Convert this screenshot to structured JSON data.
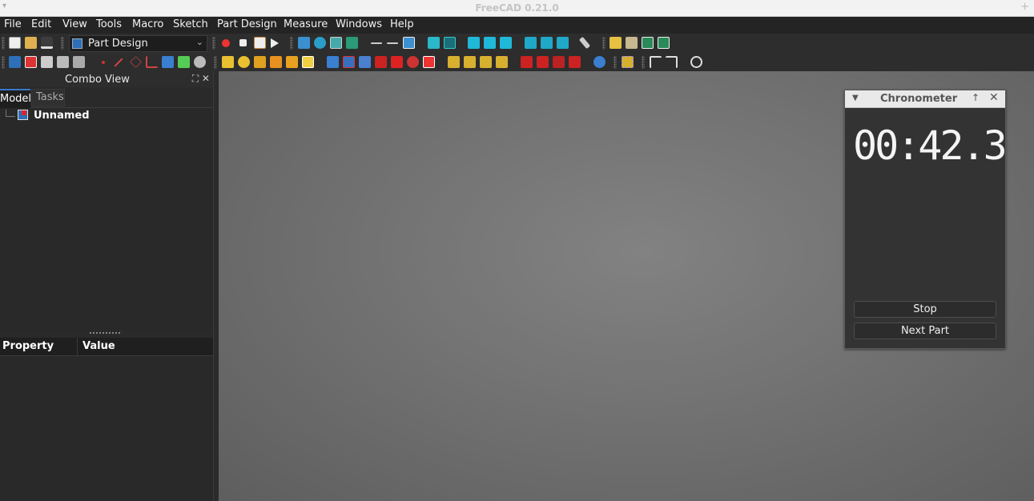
{
  "window": {
    "title": "FreeCAD 0.21.0",
    "left_glyph": "▾",
    "right_glyph": "+"
  },
  "menu": [
    "File",
    "Edit",
    "View",
    "Tools",
    "Macro",
    "Sketch",
    "Part Design",
    "Measure",
    "Windows",
    "Help"
  ],
  "workbench": {
    "selected": "Part Design"
  },
  "combo_view": {
    "title": "Combo View",
    "tabs": [
      "Model",
      "Tasks"
    ],
    "active_tab": "Model"
  },
  "tree": {
    "items": [
      {
        "label": "Unnamed",
        "icon": "document-icon"
      }
    ]
  },
  "property_view": {
    "columns": [
      "Property",
      "Value"
    ]
  },
  "chronometer": {
    "title": "Chronometer",
    "time": "00:42.3",
    "buttons": [
      "Stop",
      "Next Part"
    ]
  },
  "icons": {
    "toolbar_row1": [
      "new-document-icon",
      "open-icon",
      "save-icon",
      "workbench-icon",
      "record-macro-icon",
      "stop-macro-icon",
      "edit-macro-icon",
      "run-macro-icon",
      "fit-all-icon",
      "fit-selection-icon",
      "draw-style-icon",
      "bounding-box-icon",
      "back-icon",
      "forward-icon",
      "link-icon",
      "view-menu-icon",
      "isometric-icon",
      "front-view-icon",
      "top-view-icon",
      "right-view-icon",
      "rear-view-icon",
      "bottom-view-icon",
      "left-view-icon",
      "measure-icon",
      "part-icon",
      "group-icon",
      "link-make-icon",
      "link-actions-icon"
    ],
    "toolbar_row2": [
      "body-icon",
      "create-sketch-icon",
      "validate-sketch-icon",
      "shape-binder-icon",
      "clone-icon",
      "point-icon",
      "line-icon",
      "plane-icon",
      "csys-icon",
      "subshape-binder-icon",
      "primitives-icon",
      "pad-icon",
      "revolution-icon",
      "loft-icon",
      "pipe-icon",
      "helix-icon",
      "additive-box-icon",
      "pocket-icon",
      "hole-icon",
      "groove-icon",
      "subtractive-loft-icon",
      "subtractive-pipe-icon",
      "subtractive-helix-icon",
      "subtractive-box-icon",
      "mirrored-icon",
      "linear-pattern-icon",
      "polar-pattern-icon",
      "multi-transform-icon",
      "fillet-icon",
      "chamfer-icon",
      "draft-icon",
      "thickness-icon",
      "boolean-icon",
      "sprocket-icon",
      "undo-icon",
      "redo-icon",
      "refresh-icon"
    ]
  },
  "colors": {
    "accent": "#3b78c8",
    "viewport_center": "#828282",
    "panel": "#2a2a2a"
  }
}
